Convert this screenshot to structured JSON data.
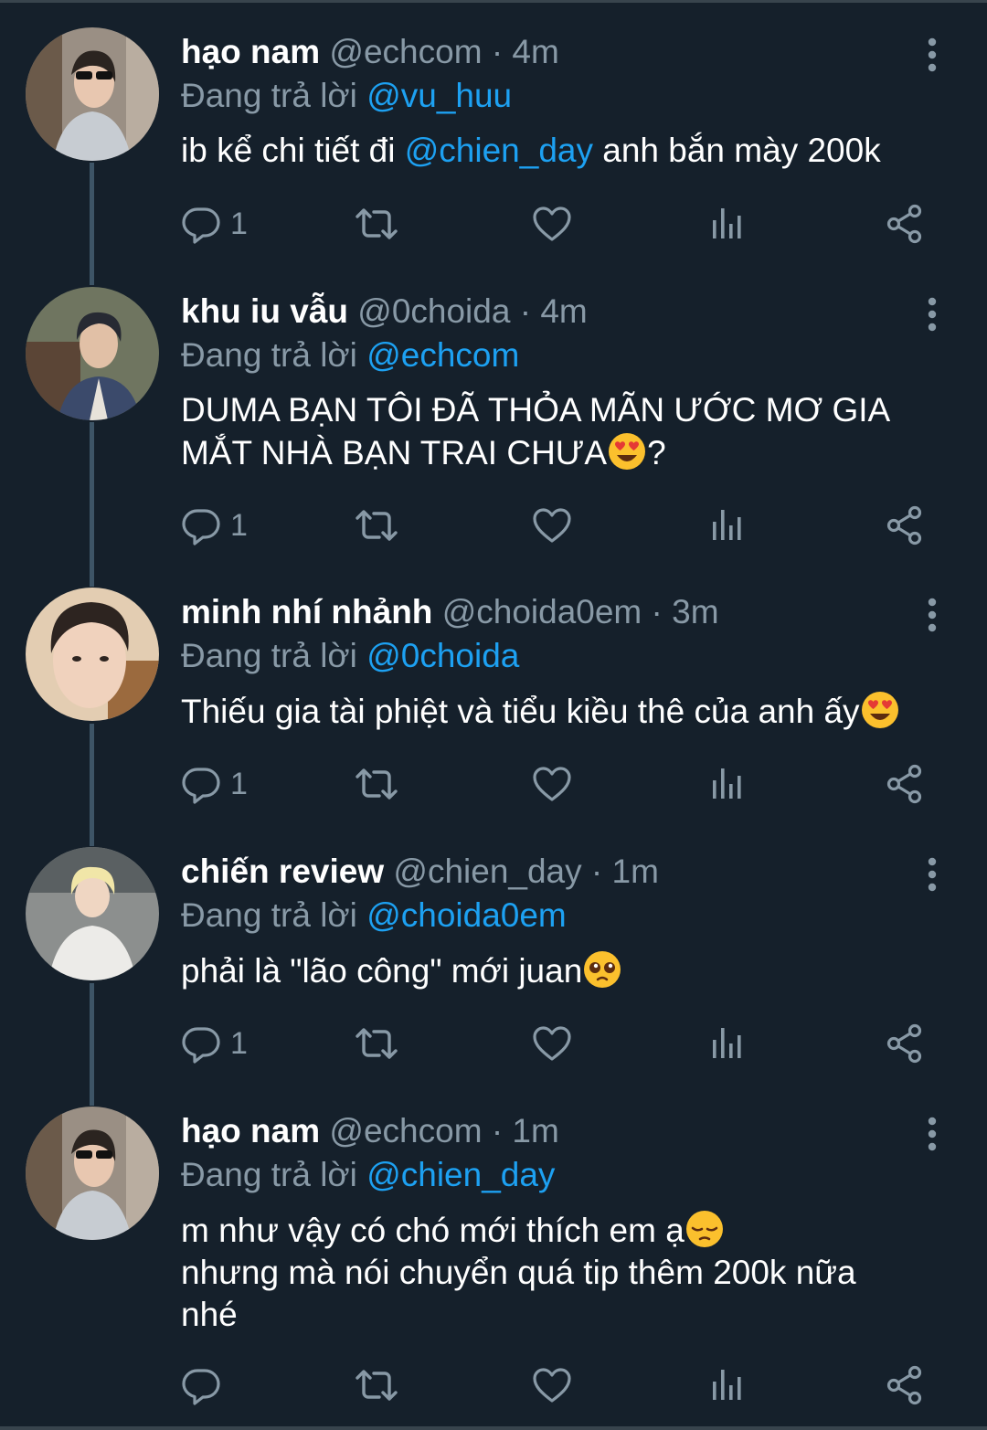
{
  "tweets": [
    {
      "name": "hạo nam",
      "handle": "@echcom",
      "time": "· 4m",
      "reply_label": "Đang trả lời",
      "reply_to": "@vu_huu",
      "body_pre": "ib kể chi tiết đi ",
      "body_mention": "@chien_day",
      "body_post": " anh bắn mày 200k",
      "reply_count": "1"
    },
    {
      "name": "khu iu vẫu",
      "handle": "@0choida",
      "time": "· 4m",
      "reply_label": "Đang trả lời",
      "reply_to": "@echcom",
      "body_text": "DUMA BẠN TÔI ĐÃ THỎA MÃN ƯỚC MƠ GIA MẮT NHÀ BẠN TRAI CHƯA",
      "body_suffix": "?",
      "reply_count": "1"
    },
    {
      "name": "minh nhí nhảnh",
      "handle": "@choida0em",
      "time": "· 3m",
      "reply_label": "Đang trả lời",
      "reply_to": "@0choida",
      "body_text": "Thiếu gia tài phiệt và tiểu kiều thê của anh ấy",
      "reply_count": "1"
    },
    {
      "name": "chiến review",
      "handle": "@chien_day",
      "time": "· 1m",
      "reply_label": "Đang trả lời",
      "reply_to": "@choida0em",
      "body_text": "phải là \"lão công\" mới juan",
      "reply_count": "1"
    },
    {
      "name": "hạo nam",
      "handle": "@echcom",
      "time": "· 1m",
      "reply_label": "Đang trả lời",
      "reply_to": "@chien_day",
      "body_line1": "m như vậy có chó mới thích em ạ",
      "body_line2": "nhưng mà nói chuyển quá tip thêm 200k nữa nhé",
      "reply_count": ""
    }
  ],
  "icons": {
    "reply": "reply-icon",
    "retweet": "retweet-icon",
    "like": "heart-icon",
    "analytics": "analytics-icon",
    "share": "share-icon",
    "more": "more-vertical-icon"
  },
  "colors": {
    "background": "#15202b",
    "accent": "#1da1f2",
    "secondary_text": "#8899a6",
    "thread_line": "#3d5466"
  }
}
